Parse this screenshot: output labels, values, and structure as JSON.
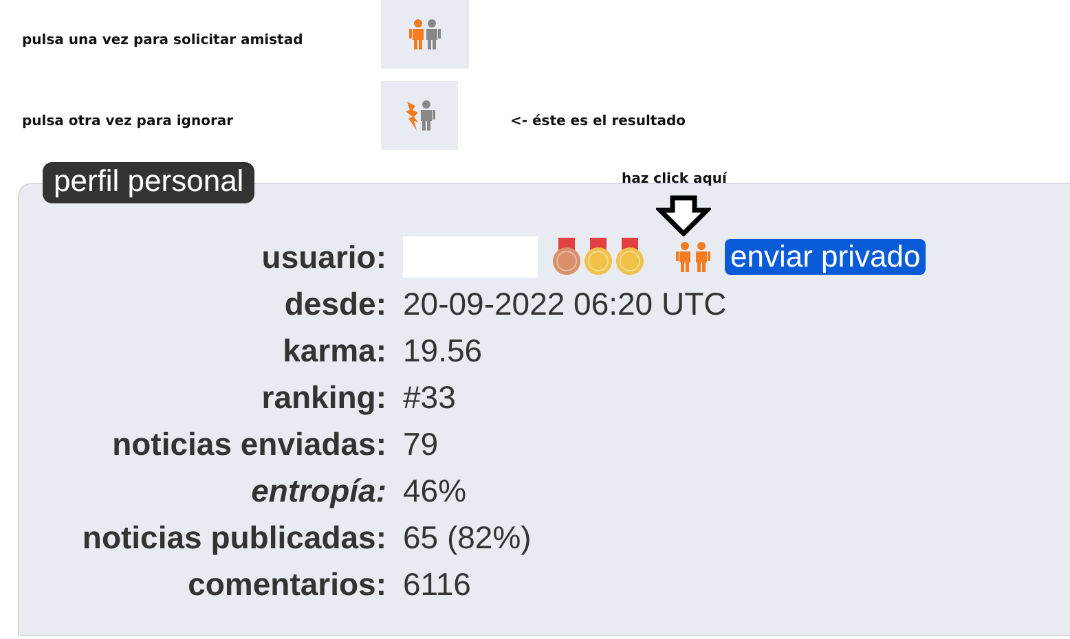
{
  "instructions": [
    {
      "text": "pulsa una vez para solicitar amistad",
      "kind": "friend"
    },
    {
      "text": "pulsa otra vez para ignorar",
      "kind": "ignore"
    }
  ],
  "result_note": "<- éste es el resultado",
  "click_hint": "haz click aquí",
  "profile": {
    "title": "perfil personal",
    "user": {
      "label": "usuario:",
      "medals": [
        {
          "color": "#d9906a"
        },
        {
          "color": "#f0c24a"
        },
        {
          "color": "#f0c24a"
        }
      ],
      "button": "enviar privado"
    },
    "rows": [
      {
        "label": "desde:",
        "value": "20-09-2022 06:20 UTC",
        "italic": false
      },
      {
        "label": "karma:",
        "value": "19.56",
        "italic": false
      },
      {
        "label": "ranking:",
        "value": "#33",
        "italic": false
      },
      {
        "label": "noticias enviadas:",
        "value": "79",
        "italic": false
      },
      {
        "label": "entropía:",
        "value": "46%",
        "italic": true
      },
      {
        "label": "noticias publicadas:",
        "value": "65 (82%)",
        "italic": false
      },
      {
        "label": "comentarios:",
        "value": "6116",
        "italic": false
      }
    ]
  }
}
